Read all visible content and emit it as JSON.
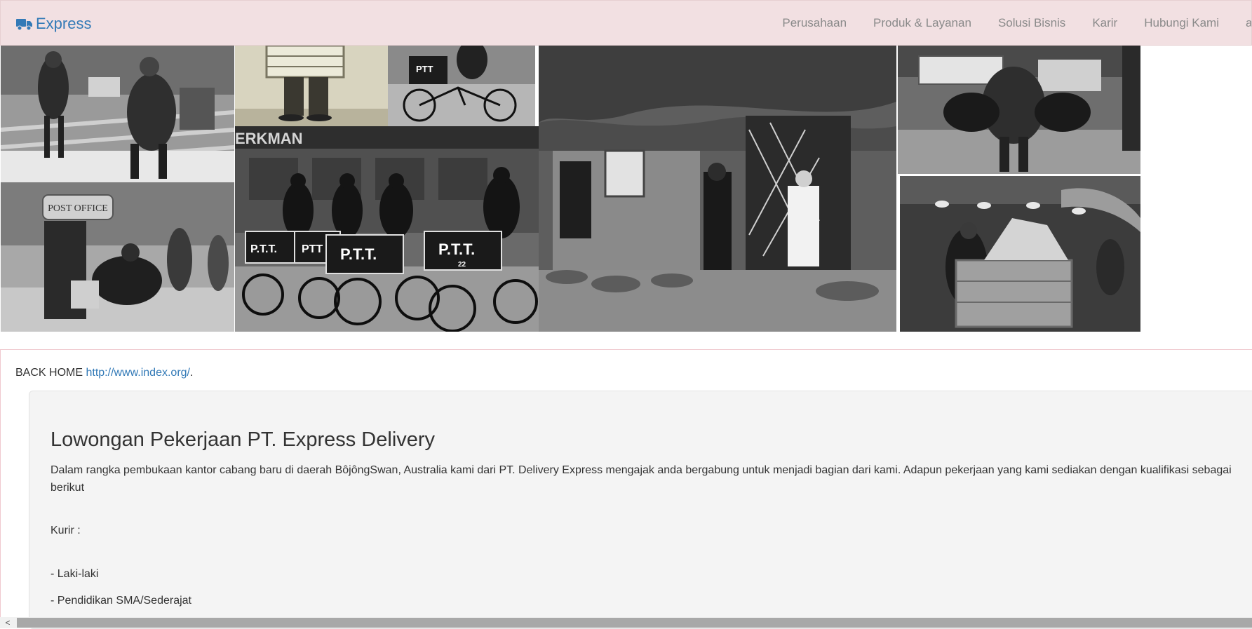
{
  "navbar": {
    "brand_label": "Express",
    "links": [
      {
        "label": "Perusahaan"
      },
      {
        "label": "Produk & Layanan"
      },
      {
        "label": "Solusi Bisnis"
      },
      {
        "label": "Karir"
      },
      {
        "label": "Hubungi Kami"
      }
    ]
  },
  "hero": {
    "photos": [
      {
        "name": "postman-stairs-photo"
      },
      {
        "name": "parcel-carrier-photo"
      },
      {
        "name": "ptt-bicycle-photo"
      },
      {
        "name": "ptt-cyclists-photo",
        "sign_text": "ERKMAN",
        "crate_labels": [
          "P.T.T.",
          "PTT",
          "P.T.T.",
          "P.T.T."
        ],
        "crate_number": "22"
      },
      {
        "name": "post-office-box-photo",
        "sign_text": "POST OFFICE"
      },
      {
        "name": "cottage-delivery-photo"
      },
      {
        "name": "mail-bags-photo"
      },
      {
        "name": "sorting-room-photo"
      }
    ]
  },
  "content": {
    "back_home_text": "BACK HOME",
    "back_home_link": "http://www.index.org/",
    "back_home_trailing": ".",
    "job": {
      "title": "Lowongan Pekerjaan PT. Express Delivery",
      "intro": "Dalam rangka pembukaan kantor cabang baru di daerah BôjôngSwan, Australia kami dari PT. Delivery Express mengajak anda bergabung untuk menjadi bagian dari kami. Adapun pekerjaan yang kami sediakan dengan kualifikasi sebagai berikut",
      "position_label": "Kurir :",
      "requirements": [
        "- Laki-laki",
        "- Pendidikan SMA/Sederajat"
      ]
    }
  },
  "scrollbar": {
    "left_arrow": "<"
  },
  "colors": {
    "navbar_bg": "#f2e0e2",
    "brand": "#337ab7",
    "nav_text": "#8a8a8a",
    "jumbotron_bg": "#f4f4f4",
    "link": "#337ab7"
  }
}
